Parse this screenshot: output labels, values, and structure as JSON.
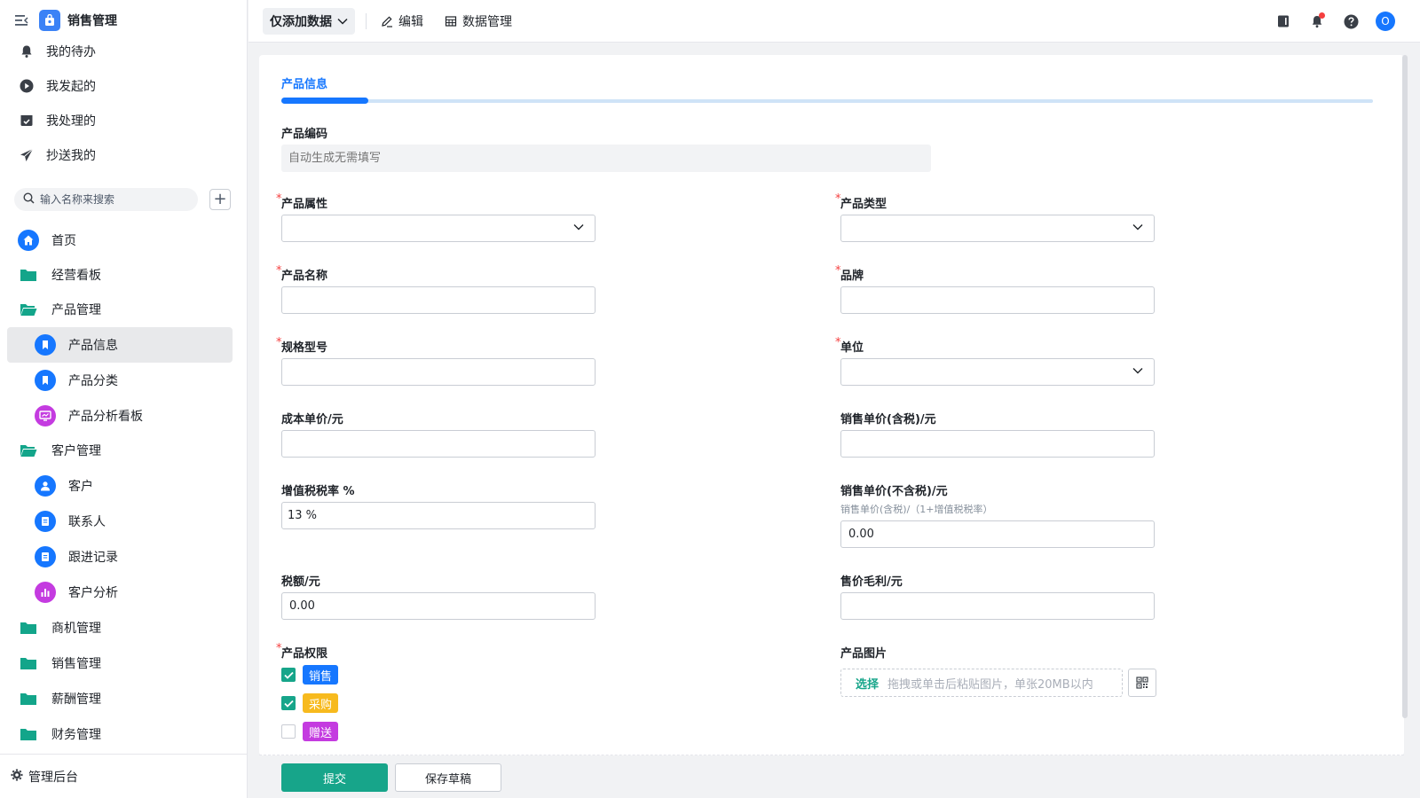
{
  "app": {
    "title": "销售管理"
  },
  "quick_links": [
    {
      "label": "我的待办",
      "icon": "bell-icon"
    },
    {
      "label": "我发起的",
      "icon": "play-circle-icon"
    },
    {
      "label": "我处理的",
      "icon": "check-box-icon"
    },
    {
      "label": "抄送我的",
      "icon": "send-icon"
    }
  ],
  "search": {
    "placeholder": "输入名称来搜索"
  },
  "nav": [
    {
      "label": "首页",
      "icon": "home-icon",
      "color": "#1677ff"
    },
    {
      "label": "经营看板",
      "icon": "folder-icon",
      "color": "#13a58a"
    },
    {
      "label": "产品管理",
      "icon": "folder-open-icon",
      "color": "#13a58a"
    },
    {
      "label": "产品信息",
      "icon": "bookmark-icon",
      "color": "#1677ff"
    },
    {
      "label": "产品分类",
      "icon": "bookmark-icon",
      "color": "#1677ff"
    },
    {
      "label": "产品分析看板",
      "icon": "dashboard-icon",
      "color": "#c43be0"
    },
    {
      "label": "客户管理",
      "icon": "folder-open-icon",
      "color": "#13a58a"
    },
    {
      "label": "客户",
      "icon": "user-icon",
      "color": "#1677ff"
    },
    {
      "label": "联系人",
      "icon": "form-icon",
      "color": "#1677ff"
    },
    {
      "label": "跟进记录",
      "icon": "form-icon",
      "color": "#1677ff"
    },
    {
      "label": "客户分析",
      "icon": "bar-chart-icon",
      "color": "#c43be0"
    },
    {
      "label": "商机管理",
      "icon": "folder-icon",
      "color": "#13a58a"
    },
    {
      "label": "销售管理",
      "icon": "folder-icon",
      "color": "#13a58a"
    },
    {
      "label": "薪酬管理",
      "icon": "folder-icon",
      "color": "#13a58a"
    },
    {
      "label": "财务管理",
      "icon": "folder-icon",
      "color": "#13a58a"
    }
  ],
  "admin": {
    "label": "管理后台"
  },
  "toolbar": {
    "view": "仅添加数据",
    "edit": "编辑",
    "data_manage": "数据管理",
    "avatar": "O"
  },
  "form": {
    "tab": "产品信息",
    "code": {
      "label": "产品编码",
      "placeholder": "自动生成无需填写"
    },
    "attribute": {
      "label": "产品属性",
      "required": "*"
    },
    "type": {
      "label": "产品类型",
      "required": "*"
    },
    "name": {
      "label": "产品名称",
      "required": "*"
    },
    "brand": {
      "label": "品牌",
      "required": "*"
    },
    "spec": {
      "label": "规格型号",
      "required": "*"
    },
    "unit": {
      "label": "单位",
      "required": "*"
    },
    "cost": {
      "label": "成本单价/元"
    },
    "price_tax": {
      "label": "销售单价(含税)/元"
    },
    "vat": {
      "label": "增值税税率 %",
      "value": "13  %"
    },
    "price_notax": {
      "label": "销售单价(不含税)/元",
      "hint": "销售单价(含税)/（1+增值税税率）",
      "value": "0.00"
    },
    "tax_amount": {
      "label": "税额/元",
      "value": "0.00"
    },
    "gross_profit": {
      "label": "售价毛利/元"
    },
    "permission": {
      "label": "产品权限",
      "required": "*",
      "options": [
        {
          "label": "销售",
          "checked": true,
          "color": "#1677ff"
        },
        {
          "label": "采购",
          "checked": true,
          "color": "#f7ba1e"
        },
        {
          "label": "赠送",
          "checked": false,
          "color": "#c43be0"
        }
      ]
    },
    "image": {
      "label": "产品图片",
      "pick": "选择",
      "tip": "拖拽或单击后粘贴图片，单张20MB以内"
    }
  },
  "actions": {
    "submit": "提交",
    "draft": "保存草稿"
  }
}
